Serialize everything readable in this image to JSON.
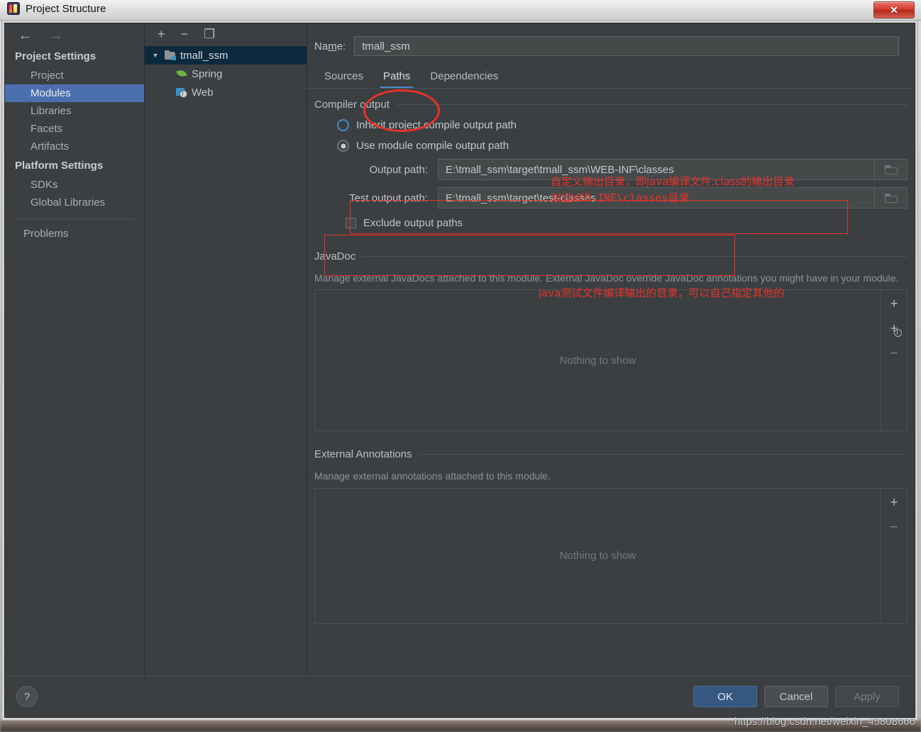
{
  "window": {
    "title": "Project Structure",
    "app_icon": "intellij-idea-icon",
    "close_label": "✕"
  },
  "nav": {
    "back_icon": "arrow-left-icon",
    "forward_icon": "arrow-right-icon"
  },
  "sidebar": {
    "groups": [
      {
        "header": "Project Settings",
        "items": [
          {
            "label": "Project",
            "selected": false
          },
          {
            "label": "Modules",
            "selected": true
          },
          {
            "label": "Libraries",
            "selected": false
          },
          {
            "label": "Facets",
            "selected": false
          },
          {
            "label": "Artifacts",
            "selected": false
          }
        ]
      },
      {
        "header": "Platform Settings",
        "items": [
          {
            "label": "SDKs",
            "selected": false
          },
          {
            "label": "Global Libraries",
            "selected": false
          }
        ]
      }
    ],
    "extra": [
      {
        "label": "Problems",
        "selected": false
      }
    ]
  },
  "module_tree": {
    "toolbar": [
      {
        "name": "add-icon",
        "glyph": "+"
      },
      {
        "name": "remove-icon",
        "glyph": "−"
      },
      {
        "name": "copy-icon",
        "glyph": "❐"
      }
    ],
    "nodes": [
      {
        "label": "tmall_ssm",
        "icon": "module-icon",
        "selected": true,
        "expanded": true,
        "twisty": "▼"
      },
      {
        "label": "Spring",
        "icon": "spring-leaf-icon",
        "selected": false
      },
      {
        "label": "Web",
        "icon": "web-icon",
        "selected": false
      }
    ]
  },
  "editor": {
    "name_label": "Name:",
    "name_value": "tmall_ssm",
    "tabs": [
      {
        "label": "Sources",
        "active": false
      },
      {
        "label": "Paths",
        "active": true
      },
      {
        "label": "Dependencies",
        "active": false
      }
    ],
    "compiler_output": {
      "group_title": "Compiler output",
      "options": [
        {
          "label": "Inherit project compile output path",
          "selected": false
        },
        {
          "label": "Use module compile output path",
          "selected": true
        }
      ],
      "output_path_label": "Output path:",
      "output_path_value": "E:\\tmall_ssm\\target\\tmall_ssm\\WEB-INF\\classes",
      "test_output_path_label": "Test output path:",
      "test_output_path_value": "E:\\tmall_ssm\\target\\test-classes",
      "exclude_label": "Exclude output paths",
      "exclude_checked": false,
      "browse_icon": "folder-icon"
    },
    "javadoc": {
      "group_title": "JavaDoc",
      "description": "Manage external JavaDocs attached to this module. External JavaDoc override JavaDoc annotations you might have in your module.",
      "empty_text": "Nothing to show",
      "buttons": [
        {
          "name": "add-javadoc-button",
          "glyph": "+"
        },
        {
          "name": "add-javadoc-url-button",
          "glyph": "+"
        },
        {
          "name": "remove-javadoc-button",
          "glyph": "−"
        }
      ]
    },
    "external_annotations": {
      "group_title": "External Annotations",
      "description": "Manage external annotations attached to this module.",
      "empty_text": "Nothing to show",
      "buttons": [
        {
          "name": "add-annotation-button",
          "glyph": "+"
        },
        {
          "name": "remove-annotation-button",
          "glyph": "−"
        }
      ]
    }
  },
  "annotations": [
    {
      "text": "自定义输出目录，即java编译文件.class的输出目录",
      "color": "#e8332a"
    },
    {
      "text": "对应WEB-INF\\classes目录",
      "color": "#e8332a"
    },
    {
      "text": "java测试文件编译输出的目录，可以自己指定其他的",
      "color": "#e8332a"
    }
  ],
  "footer": {
    "help_label": "?",
    "ok_label": "OK",
    "cancel_label": "Cancel",
    "apply_label": "Apply"
  },
  "watermark": "https://blog.csdn.net/weixin_45808666",
  "colors": {
    "accent": "#4a88c7",
    "selection": "#4b6eaf",
    "tree_selection": "#0d293e",
    "annotation_red": "#e8332a",
    "primary_button": "#365880",
    "background": "#3c3f41"
  }
}
